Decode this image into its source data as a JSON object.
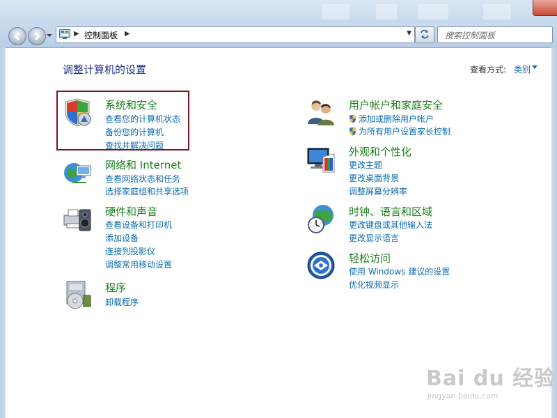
{
  "address_bar": {
    "breadcrumb": "控制面板",
    "search_placeholder": "搜索控制面板"
  },
  "main": {
    "title": "调整计算机的设置",
    "view_by_label": "查看方式:",
    "view_by_value": "类别"
  },
  "categories": [
    {
      "title": "系统和安全",
      "icon": "shield-icon",
      "links": [
        "查看您的计算机状态",
        "备份您的计算机",
        "查找并解决问题"
      ]
    },
    {
      "title": "网络和 Internet",
      "icon": "network-globe-icon",
      "links": [
        "查看网络状态和任务",
        "选择家庭组和共享选项"
      ]
    },
    {
      "title": "硬件和声音",
      "icon": "printer-speaker-icon",
      "links": [
        "查看设备和打印机",
        "添加设备",
        "连接到投影仪",
        "调整常用移动设置"
      ]
    },
    {
      "title": "程序",
      "icon": "programs-disc-icon",
      "links": [
        "卸载程序"
      ]
    },
    {
      "title": "用户帐户和家庭安全",
      "icon": "users-icon",
      "links": [
        "添加或删除用户帐户",
        "为所有用户设置家长控制"
      ]
    },
    {
      "title": "外观和个性化",
      "icon": "monitor-palette-icon",
      "links": [
        "更改主题",
        "更改桌面背景",
        "调整屏幕分辨率"
      ]
    },
    {
      "title": "时钟、语言和区域",
      "icon": "clock-globe-icon",
      "links": [
        "更改键盘或其他输入法",
        "更改显示语言"
      ]
    },
    {
      "title": "轻松访问",
      "icon": "ease-of-access-icon",
      "links": [
        "使用 Windows 建议的设置",
        "优化视频显示"
      ]
    }
  ],
  "watermark": {
    "brand": "Bai du 经验",
    "url": "jingyan.baidu.com"
  },
  "colors": {
    "category_title": "#1a7d1a",
    "link": "#0b6bb0",
    "page_title": "#1e3287",
    "highlight_border": "#7a1321"
  }
}
